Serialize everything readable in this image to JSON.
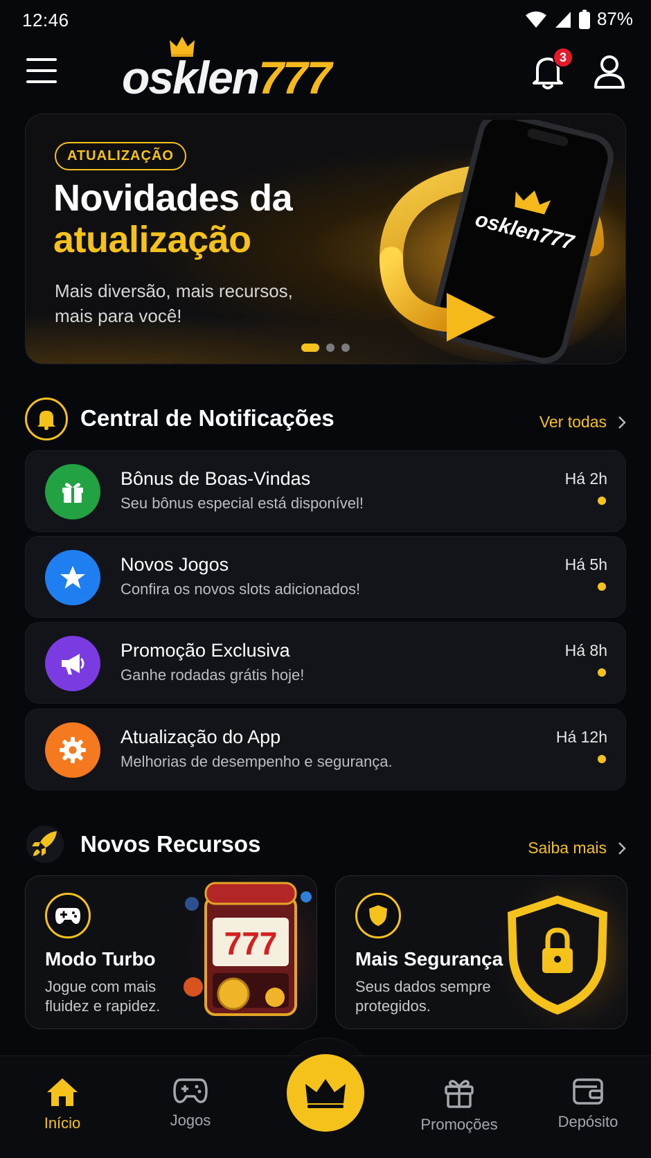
{
  "status_bar": {
    "time": "12:46",
    "battery": "87%"
  },
  "header": {
    "logo_part1": "osklen",
    "logo_part2": "777",
    "notification_count": "3"
  },
  "banner": {
    "tag": "ATUALIZAÇÃO",
    "title_line1": "Novidades da",
    "title_line2": "atualização",
    "subtitle_line1": "Mais diversão, mais recursos,",
    "subtitle_line2": "mais para você!",
    "phone_logo": "osklen777",
    "slides": 3,
    "active_slide": 1
  },
  "notifications": {
    "title": "Central de Notificações",
    "link": "Ver todas",
    "items": [
      {
        "title": "Bônus de Boas-Vindas",
        "subtitle": "Seu bônus especial está disponível!",
        "time": "Há 2h",
        "icon": "gift-icon",
        "color": "#23a243"
      },
      {
        "title": "Novos Jogos",
        "subtitle": "Confira os novos slots adicionados!",
        "time": "Há 5h",
        "icon": "star-icon",
        "color": "#1f7ff0"
      },
      {
        "title": "Promoção Exclusiva",
        "subtitle": "Ganhe rodadas grátis hoje!",
        "time": "Há 8h",
        "icon": "megaphone-icon",
        "color": "#7a3be0"
      },
      {
        "title": "Atualização do App",
        "subtitle": "Melhorias de desempenho e segurança.",
        "time": "Há 12h",
        "icon": "gear-icon",
        "color": "#f57a1f"
      }
    ]
  },
  "features": {
    "title": "Novos Recursos",
    "link": "Saiba mais",
    "items": [
      {
        "title": "Modo Turbo",
        "description": "Jogue com mais fluidez e rapidez.",
        "icon": "gamepad-icon",
        "art_text": "777"
      },
      {
        "title": "Mais Segurança",
        "description": "Seus dados sempre protegidos.",
        "icon": "shield-icon"
      }
    ]
  },
  "bottom_nav": {
    "items": [
      {
        "label": "Início",
        "icon": "home-icon",
        "active": true
      },
      {
        "label": "Jogos",
        "icon": "gamepad-icon"
      },
      {
        "label": "Promoções",
        "icon": "gift-icon"
      },
      {
        "label": "Depósito",
        "icon": "wallet-icon"
      }
    ],
    "center_icon": "crown-icon"
  },
  "colors": {
    "accent": "#f5c21b",
    "background": "#07080b",
    "card": "#121419",
    "badge": "#e31b2b"
  }
}
